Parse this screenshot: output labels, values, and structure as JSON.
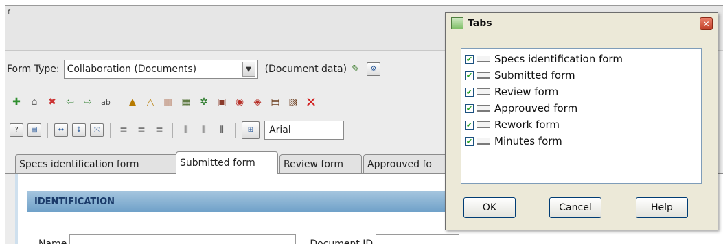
{
  "form_type": {
    "label": "Form Type:",
    "value": "Collaboration (Documents)",
    "doc_data_label": "(Document data)"
  },
  "toolbar_font": {
    "value": "Arial"
  },
  "tabs": [
    {
      "label": "Specs identification form"
    },
    {
      "label": "Submitted form"
    },
    {
      "label": "Review form"
    },
    {
      "label": "Approuved fo"
    }
  ],
  "section": {
    "title": "IDENTIFICATION"
  },
  "fields": {
    "name_label": "Name",
    "docid_label": "Document ID"
  },
  "dialog": {
    "title": "Tabs",
    "close_glyph": "✕",
    "items": [
      {
        "label": "Specs identification form",
        "checked": true
      },
      {
        "label": "Submitted form",
        "checked": true
      },
      {
        "label": "Review form",
        "checked": true
      },
      {
        "label": "Approuved form",
        "checked": true
      },
      {
        "label": "Rework form",
        "checked": true
      },
      {
        "label": "Minutes form",
        "checked": true
      }
    ],
    "ok_label": "OK",
    "cancel_label": "Cancel",
    "help_label": "Help"
  },
  "colors": {
    "accent_header": "#6ea0c8",
    "delete_red": "#d21f1f"
  }
}
